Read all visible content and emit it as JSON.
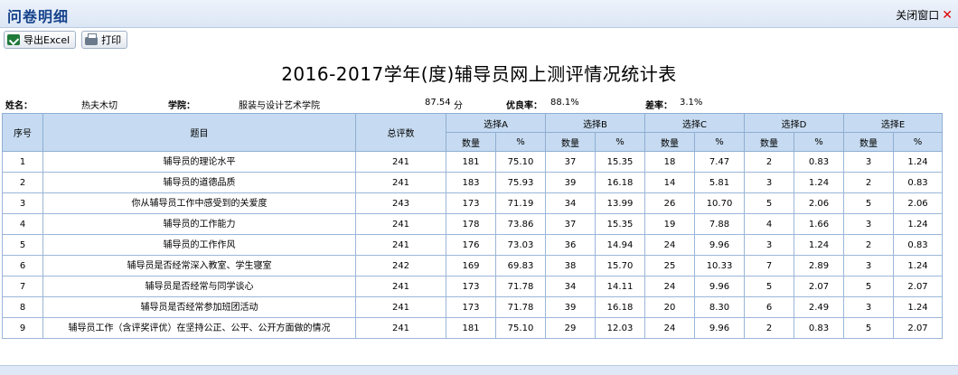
{
  "window": {
    "title": "问卷明细",
    "close_label": "关闭窗口",
    "close_glyph": "✕"
  },
  "toolbar": {
    "export_label": "导出Excel",
    "print_label": "打印"
  },
  "report": {
    "title": "2016-2017学年(度)辅导员网上测评情况统计表"
  },
  "info": {
    "name_label": "姓名：",
    "name_value": "热夫木切",
    "college_label": "学院：",
    "college_value": "服装与设计艺术学院",
    "score_value": "87.54",
    "score_unit": "分",
    "good_label": "优良率：",
    "good_value": "88.1%",
    "bad_label": "差率：",
    "bad_value": "3.1%"
  },
  "table": {
    "headers": {
      "index": "序号",
      "topic": "题目",
      "total": "总评数"
    },
    "choice_groups": [
      "选择A",
      "选择B",
      "选择C",
      "选择D",
      "选择E"
    ],
    "sub_headers": {
      "count": "数量",
      "pct": "%"
    },
    "rows": [
      {
        "index": "1",
        "topic": "辅导员的理论水平",
        "total": "241",
        "a": [
          "181",
          "75.10"
        ],
        "b": [
          "37",
          "15.35"
        ],
        "c": [
          "18",
          "7.47"
        ],
        "d": [
          "2",
          "0.83"
        ],
        "e": [
          "3",
          "1.24"
        ]
      },
      {
        "index": "2",
        "topic": "辅导员的道德品质",
        "total": "241",
        "a": [
          "183",
          "75.93"
        ],
        "b": [
          "39",
          "16.18"
        ],
        "c": [
          "14",
          "5.81"
        ],
        "d": [
          "3",
          "1.24"
        ],
        "e": [
          "2",
          "0.83"
        ]
      },
      {
        "index": "3",
        "topic": "你从辅导员工作中感受到的关爱度",
        "total": "243",
        "a": [
          "173",
          "71.19"
        ],
        "b": [
          "34",
          "13.99"
        ],
        "c": [
          "26",
          "10.70"
        ],
        "d": [
          "5",
          "2.06"
        ],
        "e": [
          "5",
          "2.06"
        ]
      },
      {
        "index": "4",
        "topic": "辅导员的工作能力",
        "total": "241",
        "a": [
          "178",
          "73.86"
        ],
        "b": [
          "37",
          "15.35"
        ],
        "c": [
          "19",
          "7.88"
        ],
        "d": [
          "4",
          "1.66"
        ],
        "e": [
          "3",
          "1.24"
        ]
      },
      {
        "index": "5",
        "topic": "辅导员的工作作风",
        "total": "241",
        "a": [
          "176",
          "73.03"
        ],
        "b": [
          "36",
          "14.94"
        ],
        "c": [
          "24",
          "9.96"
        ],
        "d": [
          "3",
          "1.24"
        ],
        "e": [
          "2",
          "0.83"
        ]
      },
      {
        "index": "6",
        "topic": "辅导员是否经常深入教室、学生寝室",
        "total": "242",
        "a": [
          "169",
          "69.83"
        ],
        "b": [
          "38",
          "15.70"
        ],
        "c": [
          "25",
          "10.33"
        ],
        "d": [
          "7",
          "2.89"
        ],
        "e": [
          "3",
          "1.24"
        ]
      },
      {
        "index": "7",
        "topic": "辅导员是否经常与同学谈心",
        "total": "241",
        "a": [
          "173",
          "71.78"
        ],
        "b": [
          "34",
          "14.11"
        ],
        "c": [
          "24",
          "9.96"
        ],
        "d": [
          "5",
          "2.07"
        ],
        "e": [
          "5",
          "2.07"
        ]
      },
      {
        "index": "8",
        "topic": "辅导员是否经常参加班团活动",
        "total": "241",
        "a": [
          "173",
          "71.78"
        ],
        "b": [
          "39",
          "16.18"
        ],
        "c": [
          "20",
          "8.30"
        ],
        "d": [
          "6",
          "2.49"
        ],
        "e": [
          "3",
          "1.24"
        ]
      },
      {
        "index": "9",
        "topic": "辅导员工作（含评奖评优）在坚持公正、公平、公开方面做的情况",
        "total": "241",
        "a": [
          "181",
          "75.10"
        ],
        "b": [
          "29",
          "12.03"
        ],
        "c": [
          "24",
          "9.96"
        ],
        "d": [
          "2",
          "0.83"
        ],
        "e": [
          "5",
          "2.07"
        ]
      }
    ]
  }
}
